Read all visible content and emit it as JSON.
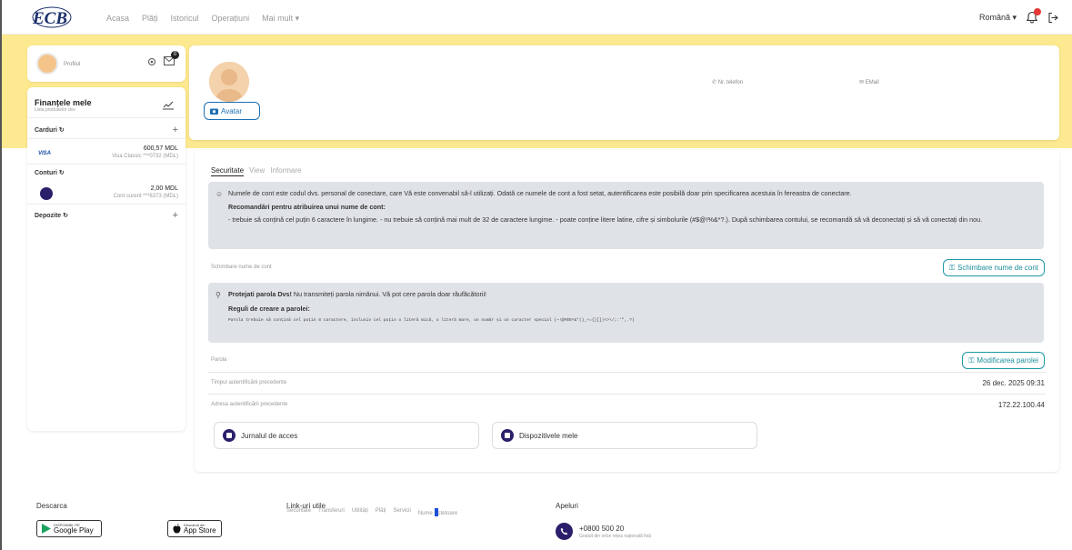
{
  "nav": {
    "logo_text": "ECB",
    "links": [
      "Acasa",
      "Plăți",
      "Istoricul",
      "Operațiuni",
      "Mai mult ▾"
    ],
    "language": "Română ▾"
  },
  "sidebar": {
    "profile_label": "Profilul",
    "notifications_count": "0",
    "finances_title": "Finanțele mele",
    "finances_subtitle": "Lista produselor dvs",
    "cards_label": "Carduri ↻",
    "card": {
      "brand": "VISA",
      "amount": "600,57 MDL",
      "desc": "Visa Classic ***0732 (MDL)"
    },
    "accounts_label": "Conturi ↻",
    "account": {
      "amount": "2,00 MDL",
      "desc": "Cont curent ***6373 (MDL)"
    },
    "deposits_label": "Depozite ↻",
    "plus": "+"
  },
  "profile": {
    "avatar_button": "Avatar",
    "phone_label": "Nr. telefon",
    "email_label": "EMail"
  },
  "security": {
    "tabs": [
      "Securitate",
      "View",
      "Informare"
    ],
    "username_info": "Numele de cont este codul dvs. personal de conectare, care Vă este convenabil să-l utilizați. Odată ce numele de cont a fost setat, autentificarea este posibilă doar prin specificarea acestuia în fereastra de conectare.",
    "username_reco_title": "Recomandări pentru atribuirea unui nume de cont:",
    "username_reco_text": "- trebuie să conțină cel puțin 6 caractere în lungime. - nu trebuie să conțină mai mult de 32 de caractere lungime. - poate conține litere latine, cifre și simbolurile (#$@!%&*?.). După schimbarea contului, se recomandă să vă deconectați și să vă conectați din nou.",
    "username_row_label": "Schimbare nume de cont",
    "username_button": "Schimbare nume de cont",
    "password_warning_bold": "Protejati parola Dvs!",
    "password_warning_text": " Nu transmiteți parola nimănui. Vă pot cere parola doar răufăcătorii!",
    "password_rules_title": "Reguli de creare a parolei:",
    "password_rules_text": "Parola trebuie să conțină cel puțin 8 caractere, inclusiv cel puțin o literă mică, o literă mare, un număr și un caracter special (~!@#$%^&*()_+={}[]|<>\\/;:'\",.?)",
    "password_row_label": "Parola",
    "password_button": "Modificarea parolei",
    "last_auth_time_label": "Timpul autentificării precedente",
    "last_auth_time_value": "26 dec. 2025 09:31",
    "last_auth_ip_label": "Adresa autentificării precedente",
    "last_auth_ip_value": "172.22.100.44",
    "access_log": "Jurnalul de acces",
    "my_devices": "Dispozitivele mele"
  },
  "footer": {
    "download_title": "Descarca",
    "google_small": "DISPONIBIL PE",
    "google_big": "Google Play",
    "apple_small": "Descarcă din",
    "apple_big": "App Store",
    "links_title": "Link-uri utile",
    "links": [
      "Securitate",
      "Transferuri",
      "Utilități",
      "Plăți",
      "Servicii",
      "Nume ",
      "ctetoare"
    ],
    "calls_title": "Apeluri",
    "phone": "+0800 500 20",
    "phone_sub": "Gratuit din orice rețea națională fixă"
  },
  "colors": {
    "band": "#fde98f",
    "accent": "#1c6fb4",
    "teal": "#1c9aa6",
    "navy": "#2a1f6b",
    "alert": "#e53935"
  }
}
